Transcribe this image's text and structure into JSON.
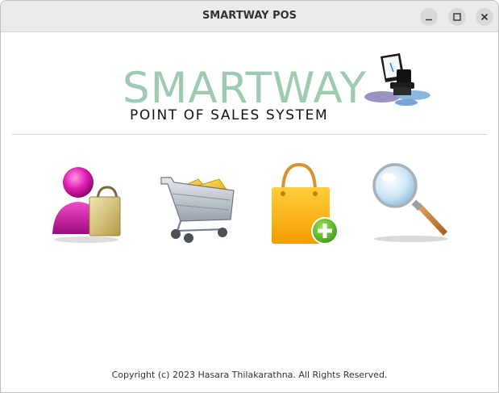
{
  "window": {
    "title": "SMARTWAY POS",
    "controls": [
      "minimize-icon",
      "maximize-icon",
      "close-icon"
    ]
  },
  "logo": {
    "name": "SMARTWAY",
    "tagline": "POINT OF SALES SYSTEM",
    "icon": "pos-terminal-icon",
    "brand_color": "#9dcab1"
  },
  "menu": {
    "tiles": [
      {
        "id": "customers",
        "icon": "customer-icon"
      },
      {
        "id": "cart",
        "icon": "shopping-cart-icon"
      },
      {
        "id": "add-product",
        "icon": "shopping-bag-add-icon"
      },
      {
        "id": "search",
        "icon": "magnifier-icon"
      }
    ]
  },
  "footer": {
    "copyright": "Copyright (c) 2023 Hasara Thilakarathna. All Rights Reserved."
  }
}
